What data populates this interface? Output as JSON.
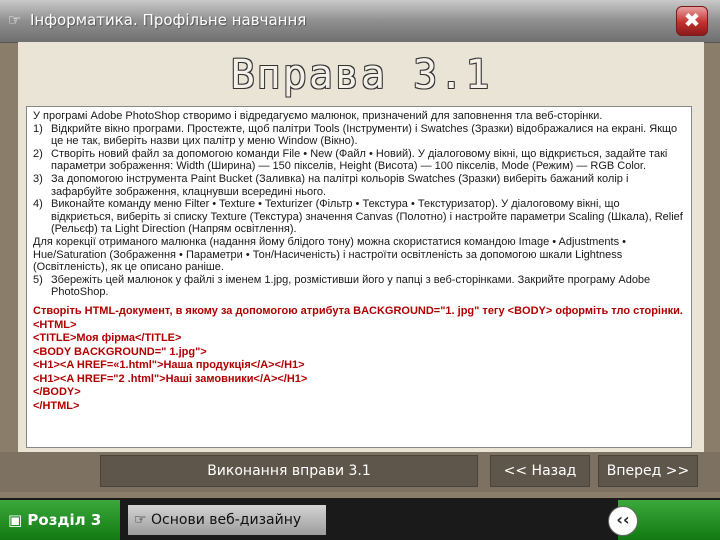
{
  "window": {
    "title": "Інформатика. Профільне навчання",
    "close_label": "✖"
  },
  "heading": "Вправа 3.1",
  "intro": "У програмі Adobe PhotoShop створимо і відредагуємо малюнок, призначений для заповнення тла веб-сторінки.",
  "steps": [
    {
      "num": "1)",
      "text": "Відкрийте вікно програми. Простежте, щоб палітри Tools (Інструменти) і Swatches (Зразки) відображалися на екрані. Якщо це не так, виберіть назви цих палітр у меню Window (Вікно)."
    },
    {
      "num": "2)",
      "text": "Створіть новий файл за допомогою команди File • New (Файл • Новий). У діалоговому вікні, що відкриється, задайте такі параметри зображення: Width (Ширина) — 150 пікселів, Height (Висота) — 100 пікселів, Mode (Режим) — RGB Color."
    },
    {
      "num": "3)",
      "text": "За допомогою інструмента Paint Bucket (Заливка) на палітрі кольорів Swatches (Зразки) виберіть бажаний колір і зафарбуйте зображення, клацнувши всередині нього."
    },
    {
      "num": "4)",
      "text": "Виконайте команду меню Filter • Texture • Texturizer (Фільтр • Текстура • Текстуризатор). У діалоговому вікні, що відкриється, виберіть зі списку Texture (Текстура) значення Canvas (Полотно) і настройте параметри Scaling (Шкала), Relief (Рельєф) та Light Direction (Напрям освітлення)."
    }
  ],
  "correction": "Для корекції отриманого малюнка (надання йому блідого тону) можна скористатися командою Image • Adjustments • Hue/Saturation (Зображення • Параметри • Тон/Насиченість) і настроїти освітленість за допомогою шкали Lightness (Освітленість), як це описано раніше.",
  "step5": {
    "num": "5)",
    "text": "Збережіть цей малюнок у файлі з іменем 1.jpg, розмістивши його у папці з веб-сторінками. Закрийте програму Adobe PhotoShop."
  },
  "code_intro": "Створіть HTML-документ, в якому за допомогою атрибута BACKGROUND=\"1. jpg\" тегу <BODY> оформіть тло сторінки.",
  "code_lines": [
    "<HTML>",
    "<TITLE>Моя фірма</TITLE>",
    "<BODY BACKGROUND=\" 1.jpg\">",
    "<H1><A HREF=«1.html\">Наша продукція</A></H1>",
    "<H1><A HREF=\"2 .html\">Наші замовники</A></H1>",
    "</BODY>",
    "</HTML>"
  ],
  "nav": {
    "run_label": "Виконання вправи 3.1",
    "back_label": "<< Назад",
    "next_label": "Вперед >>"
  },
  "footer": {
    "section_label": "Розділ 3",
    "topic_label": "Основи веб-дизайну",
    "back_icon_label": "‹‹"
  }
}
